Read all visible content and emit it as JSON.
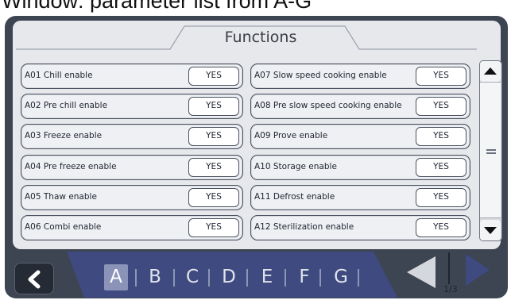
{
  "caption": "Window: parameter list from A-G",
  "header": {
    "title": "Functions"
  },
  "params": [
    {
      "code": "A01",
      "name": "Chill enable",
      "value": "YES"
    },
    {
      "code": "A02",
      "name": "Pre chill enable",
      "value": "YES"
    },
    {
      "code": "A03",
      "name": "Freeze enable",
      "value": "YES"
    },
    {
      "code": "A04",
      "name": "Pre freeze enable",
      "value": "YES"
    },
    {
      "code": "A05",
      "name": "Thaw enable",
      "value": "YES"
    },
    {
      "code": "A06",
      "name": "Combi enable",
      "value": "YES"
    },
    {
      "code": "A07",
      "name": "Slow speed cooking enable",
      "value": "YES"
    },
    {
      "code": "A08",
      "name": "Pre slow speed cooking enable",
      "value": "YES"
    },
    {
      "code": "A09",
      "name": "Prove enable",
      "value": "YES"
    },
    {
      "code": "A10",
      "name": "Storage enable",
      "value": "YES"
    },
    {
      "code": "A11",
      "name": "Defrost enable",
      "value": "YES"
    },
    {
      "code": "A12",
      "name": "Sterilization enable",
      "value": "YES"
    }
  ],
  "letters": [
    "A",
    "B",
    "C",
    "D",
    "E",
    "F",
    "G"
  ],
  "selected_letter": "A",
  "pagination": {
    "label": "1/3"
  },
  "icons": {
    "back": "back-chevron-icon",
    "scroll_up": "triangle-up-icon",
    "scroll_down": "triangle-down-icon",
    "prev": "triangle-left-icon",
    "next": "triangle-right-icon"
  },
  "colors": {
    "frame": "#3d4552",
    "panel": "#e7e8eb",
    "letter_bar": "#3e4a80",
    "selected_letter_bg": "#8b93b8",
    "next_arrow": "#3e4a80",
    "prev_arrow_disabled": "#d4d7de"
  }
}
